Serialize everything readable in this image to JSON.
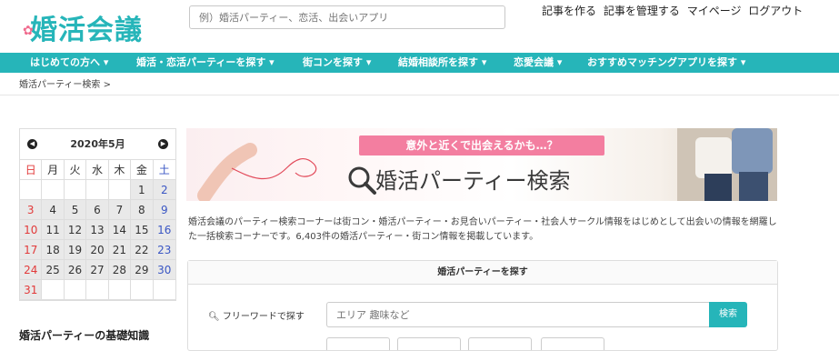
{
  "header": {
    "logo": "婚活会議",
    "search_placeholder": "例）婚活パーティー、恋活、出会いアプリ",
    "links": [
      "記事を作る",
      "記事を管理する",
      "マイページ",
      "ログアウト"
    ]
  },
  "nav": {
    "items": [
      "はじめての方へ ▾",
      "婚活・恋活パーティーを探す ▾",
      "街コンを探す ▾",
      "結婚相談所を探す ▾",
      "恋愛会議 ▾",
      "おすすめマッチングアプリを探す ▾"
    ]
  },
  "breadcrumb": "婚活パーティー検索 >",
  "calendar": {
    "month": "2020年5月",
    "weekdays": [
      "日",
      "月",
      "火",
      "水",
      "木",
      "金",
      "土"
    ],
    "rows": [
      [
        "",
        "",
        "",
        "",
        "",
        "1",
        "2"
      ],
      [
        "3",
        "4",
        "5",
        "6",
        "7",
        "8",
        "9"
      ],
      [
        "10",
        "11",
        "12",
        "13",
        "14",
        "15",
        "16"
      ],
      [
        "17",
        "18",
        "19",
        "20",
        "21",
        "22",
        "23"
      ],
      [
        "24",
        "25",
        "26",
        "27",
        "28",
        "29",
        "30"
      ],
      [
        "31",
        "",
        "",
        "",
        "",
        "",
        ""
      ]
    ]
  },
  "sidebar": {
    "title": "婚活パーティーの基礎知識"
  },
  "banner": {
    "pill": "意外と近くで出会えるかも…？",
    "title": "婚活パーティー検索"
  },
  "description": "婚活会議のパーティー検索コーナーは街コン・婚活パーティー・お見合いパーティー・社会人サークル情報をはじめとして出会いの情報を網羅した一括検索コーナーです。6,403件の婚活パーティー・街コン情報を掲載しています。",
  "panel": {
    "title": "婚活パーティーを探す",
    "freeword_label": "フリーワードで探す",
    "freeword_placeholder": "エリア 趣味など",
    "search_button": "検索"
  },
  "colors": {
    "accent": "#26b5b9",
    "pink": "#f37ea0"
  }
}
